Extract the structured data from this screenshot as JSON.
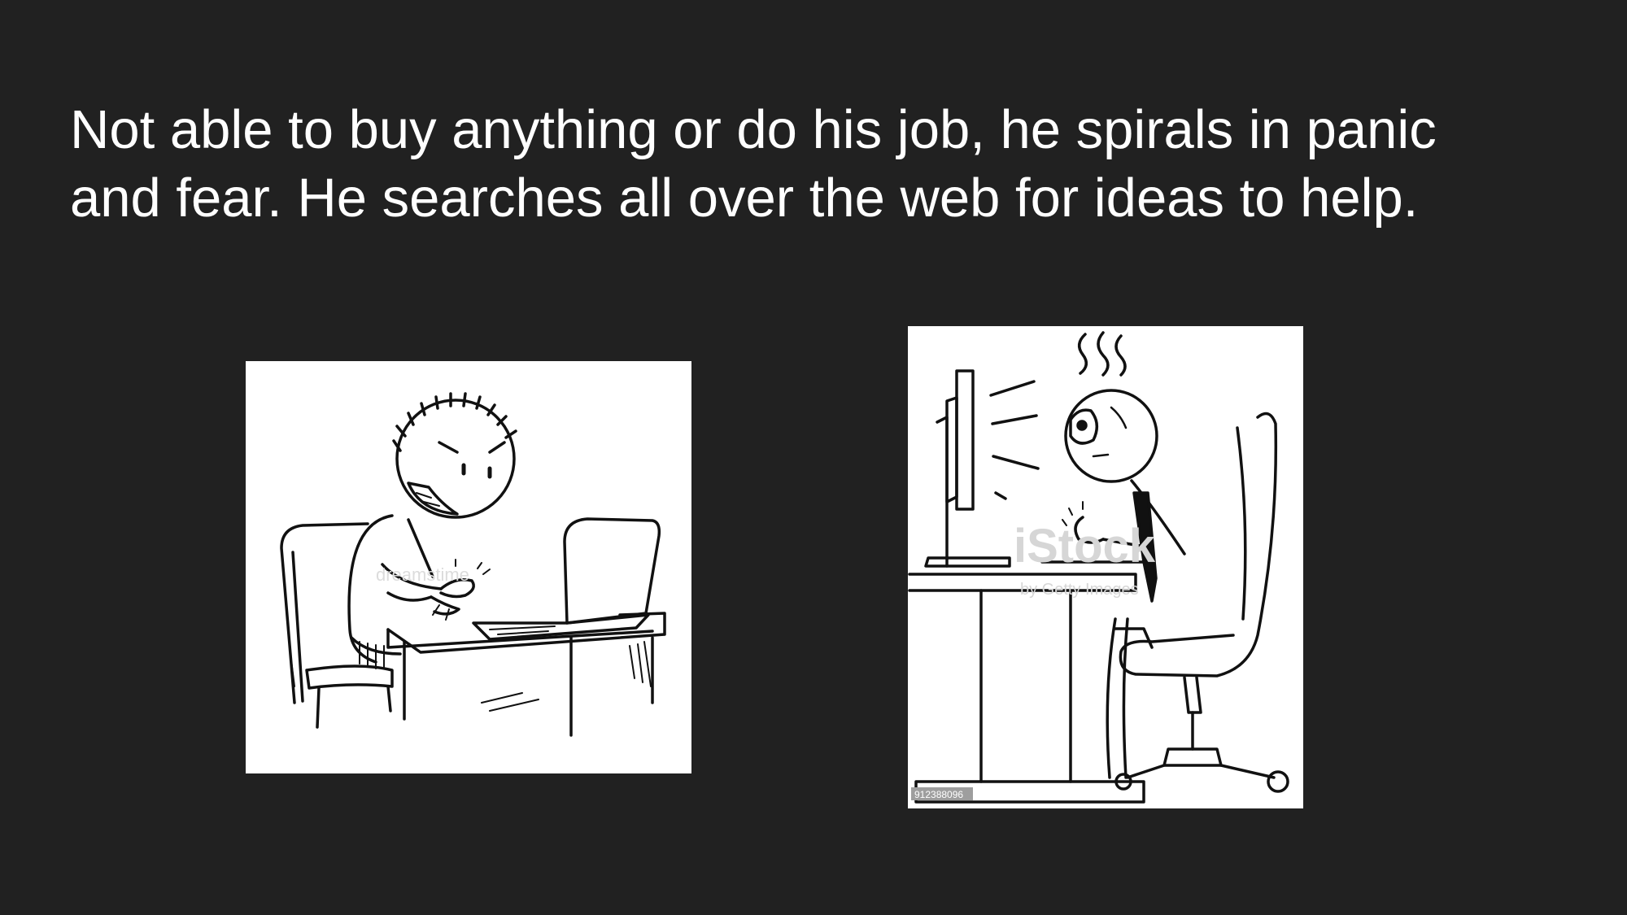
{
  "slide": {
    "background": "#212121",
    "text_color": "#ffffff",
    "body_lines": [
      "Not able to buy anything or do his job, he spirals in panic",
      "and fear. He searches all over the web for ideas to help."
    ]
  },
  "images": {
    "left": {
      "icon": "angry-man-typing-on-laptop-cartoon",
      "watermark": "dreamstime"
    },
    "right": {
      "icon": "stressed-man-at-computer-cartoon",
      "watermark": "iStock",
      "watermark_sub": "by Getty Images",
      "stock_id": "912388096"
    }
  }
}
